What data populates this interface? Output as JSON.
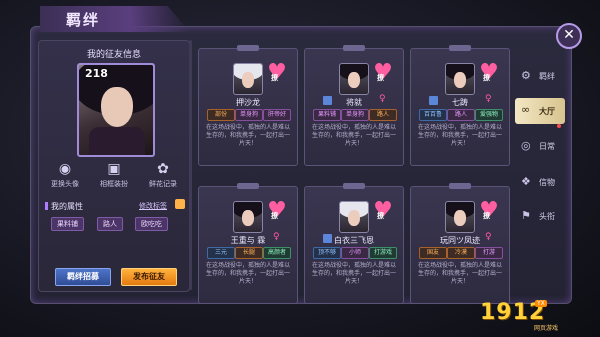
{
  "window_title": "羁绊",
  "close_icon": "close-icon",
  "profile": {
    "panel_title": "我的征友信息",
    "level": "218",
    "actions": [
      {
        "label": "更换头像",
        "icon": "camera-icon"
      },
      {
        "label": "相框装扮",
        "icon": "frame-icon"
      },
      {
        "label": "鲜花记录",
        "icon": "flower-icon"
      }
    ],
    "attributes_title": "我的属性",
    "edit_tags_label": "修改标签",
    "tags": [
      "果料铺",
      "路人",
      "欧吃吃"
    ],
    "buttons": {
      "recruit": "羁绊招募",
      "publish": "发布征友"
    }
  },
  "cards": [
    {
      "name": "押沙龙",
      "tags": [
        "部份",
        "单身狗",
        "肝帝好"
      ],
      "heart_label": "撩",
      "desc": "在这场战役中，孤独的人是难以生存的，和我携手，一起打出一片天！"
    },
    {
      "name": "将就",
      "tags": [
        "果料铺",
        "单身狗",
        "路人"
      ],
      "heart_label": "撩",
      "desc": "在这场战役中，孤独的人是难以生存的，和我携手，一起打出一片天！"
    },
    {
      "name": "七踌",
      "tags": [
        "百百鲁",
        "路人",
        "爱强物"
      ],
      "heart_label": "撩",
      "desc": "在这场战役中，孤独的人是难以生存的，和我携手，一起打出一片天！"
    },
    {
      "name": "王重与 霖",
      "tags": [
        "三元",
        "长腿",
        "高颜者"
      ],
      "heart_label": "撩",
      "desc": "在这场战役中，孤独的人是难以生存的，和我携手，一起打出一片天！"
    },
    {
      "name": "白衣三飞恩",
      "tags": [
        "顶不够",
        "小师",
        "打游戏"
      ],
      "heart_label": "撩",
      "desc": "在这场战役中，孤独的人是难以生存的，和我携手，一起打出一片天！"
    },
    {
      "name": "玩同ツ凤迹",
      "tags": [
        "国友",
        "冷漠",
        "打游"
      ],
      "heart_label": "撩",
      "desc": "在这场战役中，孤独的人是难以生存的，和我携手，一起打出一片天！"
    }
  ],
  "nav": [
    {
      "label": "羁绊",
      "icon": "gears-icon"
    },
    {
      "label": "大厅",
      "icon": "link-icon"
    },
    {
      "label": "日常",
      "icon": "target-icon"
    },
    {
      "label": "信物",
      "icon": "gift-icon"
    },
    {
      "label": "头衔",
      "icon": "flag-icon"
    }
  ],
  "watermark": {
    "number": "1912",
    "badge": "YX",
    "site": "网页游戏"
  }
}
